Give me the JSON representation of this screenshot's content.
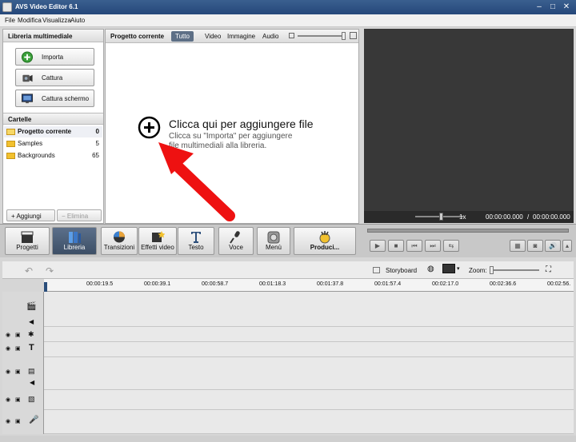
{
  "window": {
    "title": "AVS Video Editor 6.1"
  },
  "menu": [
    "File",
    "Modifica",
    "Visualizza",
    "Aiuto"
  ],
  "library": {
    "title": "Libreria multimediale",
    "buttons": [
      {
        "label": "Importa",
        "icon": "plus-circle-icon"
      },
      {
        "label": "Cattura",
        "icon": "camera-icon"
      },
      {
        "label": "Cattura schermo",
        "icon": "screen-capture-icon"
      }
    ],
    "folders_title": "Cartelle",
    "folders": [
      {
        "name": "Progetto corrente",
        "count": "0"
      },
      {
        "name": "Samples",
        "count": "5"
      },
      {
        "name": "Backgrounds",
        "count": "65"
      }
    ],
    "add_label": "Aggiungi",
    "remove_label": "Elimina"
  },
  "project": {
    "title": "Progetto corrente",
    "filters": [
      "Tutto",
      "Video",
      "Immagine",
      "Audio"
    ],
    "active_filter": "Tutto",
    "add_main": "Clicca qui per aggiungere file",
    "add_sub1": "Clicca su  \"Importa\" per aggiungere",
    "add_sub2": "file multimediali alla libreria."
  },
  "preview": {
    "speed": "1x",
    "time_current": "00:00:00.000",
    "time_separator": "/",
    "time_total": "00:00:00.000"
  },
  "toolbar": {
    "buttons": [
      {
        "label": "Progetti",
        "icon": "clapperboard-icon"
      },
      {
        "label": "Libreria",
        "icon": "library-icon",
        "active": true
      },
      {
        "label": "Transizioni",
        "icon": "transitions-icon"
      },
      {
        "label": "Effetti video",
        "icon": "video-effects-icon"
      },
      {
        "label": "Testo",
        "icon": "text-icon"
      },
      {
        "label": "Voce",
        "icon": "microphone-icon"
      },
      {
        "label": "Menù",
        "icon": "disc-menu-icon"
      },
      {
        "label": "Produci...",
        "icon": "produce-icon"
      }
    ]
  },
  "timeline": {
    "storyboard_label": "Storyboard",
    "zoom_label": "Zoom:",
    "ruler": [
      "00:00:19.5",
      "00:00:39.1",
      "00:00:58.7",
      "00:01:18.3",
      "00:01:37.8",
      "00:01:57.4",
      "00:02:17.0",
      "00:02:36.6",
      "00:02:56."
    ]
  },
  "colors": {
    "accent": "#d01f1f",
    "titlebar": "#2f5386",
    "preview_bg": "#383838"
  }
}
